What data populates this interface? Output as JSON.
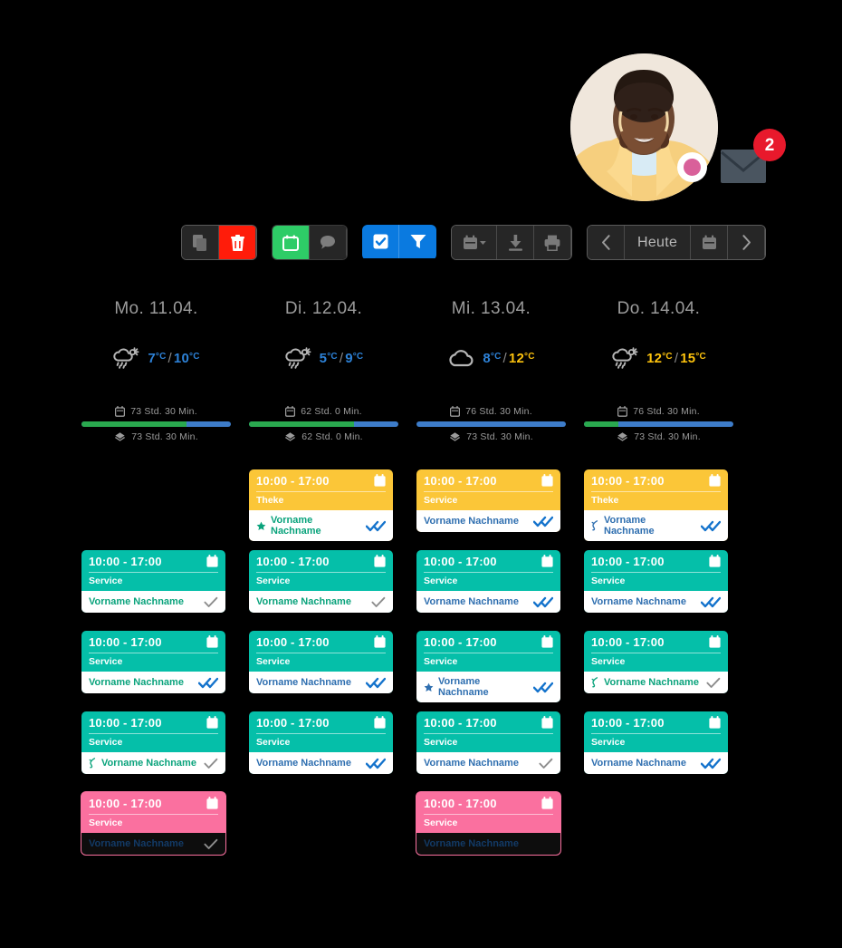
{
  "header": {
    "avatar_name": "avatar",
    "status_dot_color": "#d9609a",
    "mail_badge_count": "2"
  },
  "toolbar": {
    "groups": [
      {
        "name": "copy-delete",
        "buttons": [
          {
            "name": "copy-button",
            "icon": "copy-icon",
            "style": "dark"
          },
          {
            "name": "delete-button",
            "icon": "trash-icon",
            "style": "red"
          }
        ]
      },
      {
        "name": "calendar-comment",
        "buttons": [
          {
            "name": "calendar-button",
            "icon": "calendar-icon",
            "style": "green"
          },
          {
            "name": "comment-button",
            "icon": "comment-icon",
            "style": "dark"
          }
        ]
      },
      {
        "name": "select-filter",
        "buttons": [
          {
            "name": "select-all-button",
            "icon": "checkbox-checked-icon",
            "style": "blue"
          },
          {
            "name": "filter-button",
            "icon": "funnel-icon",
            "style": "blue"
          }
        ]
      },
      {
        "name": "export-print",
        "buttons": [
          {
            "name": "calendar-dropdown-button",
            "icon": "calendar-chevron-icon",
            "style": "dark"
          },
          {
            "name": "download-button",
            "icon": "download-icon",
            "style": "dark"
          },
          {
            "name": "print-button",
            "icon": "printer-icon",
            "style": "dark"
          }
        ]
      },
      {
        "name": "date-navigation",
        "buttons": [
          {
            "name": "prev-day-button",
            "icon": "chevron-left-icon",
            "style": "dark"
          },
          {
            "name": "today-button",
            "icon": "",
            "style": "dark",
            "label": "Heute"
          },
          {
            "name": "date-picker-button",
            "icon": "calendar-icon",
            "style": "dark"
          },
          {
            "name": "next-day-button",
            "icon": "chevron-right-icon",
            "style": "dark"
          }
        ]
      }
    ],
    "today_label": "Heute"
  },
  "days": [
    {
      "name": "Mo. 11.04.",
      "weather_icon": "sun-cloud-rain-icon",
      "temp_low": "7",
      "temp_high": "10",
      "unit": "°C",
      "temp_low_color": "blue",
      "temp_high_color": "blue",
      "planned_label": "73 Std. 30 Min.",
      "worked_label": "73 Std. 30 Min.",
      "bar_green_pct": 70,
      "slots": [
        null,
        {
          "color": "teal",
          "time": "10:00 - 17:00",
          "service": "Service",
          "name": "Vorname Nachname",
          "name_color": "green",
          "lead_icon": null,
          "check": "single"
        },
        {
          "color": "teal",
          "time": "10:00 - 17:00",
          "service": "Service",
          "name": "Vorname Nachname",
          "name_color": "green",
          "lead_icon": null,
          "check": "double"
        },
        {
          "color": "teal",
          "time": "10:00 - 17:00",
          "service": "Service",
          "name": "Vorname Nachname",
          "name_color": "green",
          "lead_icon": "curl-green",
          "check": "single"
        },
        {
          "color": "pink",
          "time": "10:00 - 17:00",
          "service": "Service",
          "name": "Vorname Nachname",
          "name_color": "dark",
          "lead_icon": null,
          "check": "single"
        }
      ]
    },
    {
      "name": "Di. 12.04.",
      "weather_icon": "sun-cloud-rain-icon",
      "temp_low": "5",
      "temp_high": "9",
      "unit": "°C",
      "temp_low_color": "blue",
      "temp_high_color": "blue",
      "planned_label": "62 Std. 0 Min.",
      "worked_label": "62 Std. 0 Min.",
      "bar_green_pct": 70,
      "slots": [
        {
          "color": "yellow",
          "time": "10:00 - 17:00",
          "service": "Theke",
          "name": "Vorname Nachname",
          "name_color": "green",
          "lead_icon": "star-green",
          "check": "double"
        },
        {
          "color": "teal",
          "time": "10:00 - 17:00",
          "service": "Service",
          "name": "Vorname Nachname",
          "name_color": "green",
          "lead_icon": null,
          "check": "single"
        },
        {
          "color": "teal",
          "time": "10:00 - 17:00",
          "service": "Service",
          "name": "Vorname Nachname",
          "name_color": "blue",
          "lead_icon": null,
          "check": "double"
        },
        {
          "color": "teal",
          "time": "10:00 - 17:00",
          "service": "Service",
          "name": "Vorname Nachname",
          "name_color": "blue",
          "lead_icon": null,
          "check": "double"
        },
        null
      ]
    },
    {
      "name": "Mi. 13.04.",
      "weather_icon": "cloud-icon",
      "temp_low": "8",
      "temp_high": "12",
      "unit": "°C",
      "temp_low_color": "blue",
      "temp_high_color": "yellow",
      "planned_label": "76 Std. 30 Min.",
      "worked_label": "73 Std. 30 Min.",
      "bar_green_pct": 0,
      "slots": [
        {
          "color": "yellow",
          "time": "10:00 - 17:00",
          "service": "Service",
          "name": "Vorname Nachname",
          "name_color": "blue",
          "lead_icon": null,
          "check": "double"
        },
        {
          "color": "teal",
          "time": "10:00 - 17:00",
          "service": "Service",
          "name": "Vorname Nachname",
          "name_color": "blue",
          "lead_icon": null,
          "check": "double"
        },
        {
          "color": "teal",
          "time": "10:00 - 17:00",
          "service": "Service",
          "name": "Vorname Nachname",
          "name_color": "blue",
          "lead_icon": "star-blue",
          "check": "double"
        },
        {
          "color": "teal",
          "time": "10:00 - 17:00",
          "service": "Service",
          "name": "Vorname Nachname",
          "name_color": "blue",
          "lead_icon": null,
          "check": "single"
        },
        {
          "color": "pink",
          "time": "10:00 - 17:00",
          "service": "Service",
          "name": "Vorname Nachname",
          "name_color": "dark",
          "lead_icon": null,
          "check": "none"
        }
      ]
    },
    {
      "name": "Do. 14.04.",
      "weather_icon": "sun-cloud-rain-icon",
      "temp_low": "12",
      "temp_high": "15",
      "unit": "°C",
      "temp_low_color": "yellow",
      "temp_high_color": "yellow",
      "planned_label": "76 Std. 30 Min.",
      "worked_label": "73 Std. 30 Min.",
      "bar_green_pct": 23,
      "slots": [
        {
          "color": "yellow",
          "time": "10:00 - 17:00",
          "service": "Theke",
          "name": "Vorname Nachname",
          "name_color": "blue",
          "lead_icon": "curl-blue",
          "check": "double"
        },
        {
          "color": "teal",
          "time": "10:00 - 17:00",
          "service": "Service",
          "name": "Vorname Nachname",
          "name_color": "blue",
          "lead_icon": null,
          "check": "double"
        },
        {
          "color": "teal",
          "time": "10:00 - 17:00",
          "service": "Service",
          "name": "Vorname Nachname",
          "name_color": "green",
          "lead_icon": "curl-green",
          "check": "single"
        },
        {
          "color": "teal",
          "time": "10:00 - 17:00",
          "service": "Service",
          "name": "Vorname Nachname",
          "name_color": "blue",
          "lead_icon": null,
          "check": "double"
        },
        null
      ]
    }
  ]
}
